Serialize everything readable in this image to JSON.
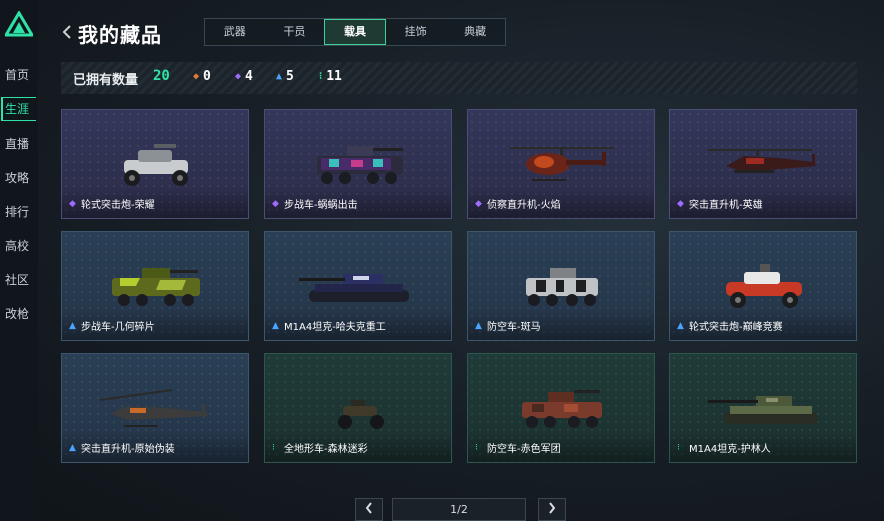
{
  "sidebar": {
    "items": [
      {
        "label": "首页"
      },
      {
        "label": "生涯"
      },
      {
        "label": "直播"
      },
      {
        "label": "攻略"
      },
      {
        "label": "排行"
      },
      {
        "label": "高校"
      },
      {
        "label": "社区"
      },
      {
        "label": "改枪"
      }
    ],
    "active": "生涯"
  },
  "header": {
    "title": "我的藏品",
    "tabs": [
      {
        "label": "武器"
      },
      {
        "label": "干员"
      },
      {
        "label": "载具"
      },
      {
        "label": "挂饰"
      },
      {
        "label": "典藏"
      }
    ],
    "active_tab": "载具"
  },
  "summary": {
    "owned_label": "已拥有数量",
    "owned_count": "20",
    "rarities": [
      {
        "icon": "orange-diamond-icon",
        "color": "#e07a3a",
        "count": "0"
      },
      {
        "icon": "purple-diamond-icon",
        "color": "#a06bff",
        "count": "4"
      },
      {
        "icon": "blue-diamond-icon",
        "color": "#4aa3ff",
        "count": "5"
      },
      {
        "icon": "green-diamond-icon",
        "color": "#2fe3a8",
        "count": "11"
      }
    ]
  },
  "cards": [
    {
      "name": "轮式突击炮-荣耀",
      "rarity": "purple"
    },
    {
      "name": "步战车-蜗蜗出击",
      "rarity": "purple"
    },
    {
      "name": "侦察直升机-火焰",
      "rarity": "purple"
    },
    {
      "name": "突击直升机-英雄",
      "rarity": "purple"
    },
    {
      "name": "步战车-几何碎片",
      "rarity": "blue"
    },
    {
      "name": "M1A4坦克-哈夫克重工",
      "rarity": "blue"
    },
    {
      "name": "防空车-斑马",
      "rarity": "blue"
    },
    {
      "name": "轮式突击炮-巅峰竞赛",
      "rarity": "blue"
    },
    {
      "name": "突击直升机-原始伪装",
      "rarity": "blue"
    },
    {
      "name": "全地形车-森林迷彩",
      "rarity": "green"
    },
    {
      "name": "防空车-赤色军团",
      "rarity": "green"
    },
    {
      "name": "M1A4坦克-护林人",
      "rarity": "green"
    }
  ],
  "pagination": {
    "page_label": "1/2",
    "prev_icon": "chevron-left-icon",
    "next_icon": "chevron-right-icon"
  },
  "colors": {
    "accent": "#2fe3a8",
    "purple": "#a06bff",
    "blue": "#4aa3ff",
    "green": "#2fe3a8"
  }
}
